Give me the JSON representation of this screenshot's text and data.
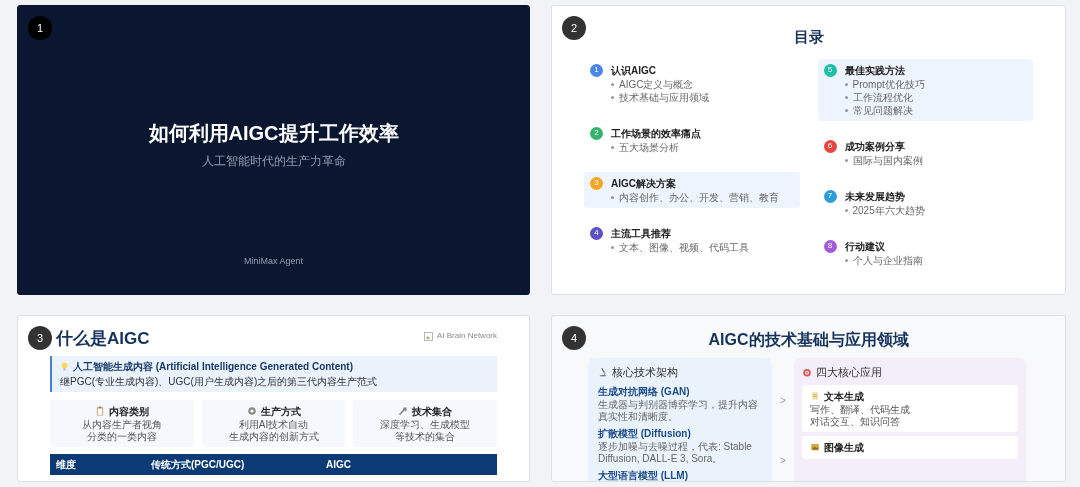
{
  "slides": [
    {
      "number": "1",
      "kind": "title",
      "title": "如何利用AIGC提升工作效率",
      "subtitle": "人工智能时代的生产力革命",
      "footer": "MiniMax Agent"
    },
    {
      "number": "2",
      "kind": "toc",
      "title": "目录",
      "columns": [
        [
          {
            "number": "1",
            "title": "认识AIGC",
            "color": "#4a86e8",
            "highlighted": false,
            "bullets": [
              "AIGC定义与概念",
              "技术基础与应用领域"
            ]
          },
          {
            "number": "2",
            "title": "工作场景的效率痛点",
            "color": "#34b36b",
            "highlighted": false,
            "bullets": [
              "五大场景分析"
            ]
          },
          {
            "number": "3",
            "title": "AIGC解决方案",
            "color": "#f5a623",
            "highlighted": true,
            "bullets": [
              "内容创作、办公、开发、营销、教育"
            ]
          },
          {
            "number": "4",
            "title": "主流工具推荐",
            "color": "#5b4fc4",
            "highlighted": false,
            "bullets": [
              "文本、图像、视频、代码工具"
            ]
          }
        ],
        [
          {
            "number": "5",
            "title": "最佳实践方法",
            "color": "#1bbfa6",
            "highlighted": true,
            "bullets": [
              "Prompt优化技巧",
              "工作流程优化",
              "常见问题解决"
            ]
          },
          {
            "number": "6",
            "title": "成功案例分享",
            "color": "#e8453c",
            "highlighted": false,
            "bullets": [
              "国际与国内案例"
            ]
          },
          {
            "number": "7",
            "title": "未来发展趋势",
            "color": "#2d9cdb",
            "highlighted": false,
            "bullets": [
              "2025年六大趋势"
            ]
          },
          {
            "number": "8",
            "title": "行动建议",
            "color": "#a45ad8",
            "highlighted": false,
            "bullets": [
              "个人与企业指南"
            ]
          }
        ]
      ]
    },
    {
      "number": "3",
      "kind": "intro",
      "title": "什么是AIGC",
      "image_alt": "AI Brain Network",
      "callout": {
        "title": "人工智能生成内容 (Artificial Intelligence Generated Content)",
        "text": "继PGC(专业生成内容)、UGC(用户生成内容)之后的第三代内容生产范式"
      },
      "cards": [
        {
          "title": "内容类别",
          "lines": [
            "从内容生产者视角",
            "分类的一类内容"
          ]
        },
        {
          "title": "生产方式",
          "lines": [
            "利用AI技术自动",
            "生成内容的创新方式"
          ]
        },
        {
          "title": "技术集合",
          "lines": [
            "深度学习、生成模型",
            "等技术的集合"
          ]
        }
      ],
      "table": {
        "columns": [
          "维度",
          "传统方式(PGC/UGC)",
          "AIGC"
        ]
      }
    },
    {
      "number": "4",
      "kind": "tech",
      "title": "AIGC的技术基础与应用领域",
      "left": {
        "title": "核心技术架构",
        "entries": [
          {
            "title": "生成对抗网络 (GAN)",
            "text": "生成器与判别器博弈学习，提升内容真实性和清晰度。"
          },
          {
            "title": "扩散模型 (Diffusion)",
            "text": "逐步加噪与去噪过程，代表: Stable Diffusion, DALL-E 3, Sora。"
          },
          {
            "title": "大型语言模型 (LLM)"
          }
        ]
      },
      "arrows": [
        ">",
        ">"
      ],
      "right": {
        "title": "四大核心应用",
        "cards": [
          {
            "title": "文本生成",
            "lines": [
              "写作、翻译、代码生成",
              "对话交互、知识问答"
            ]
          },
          {
            "title": "图像生成"
          }
        ]
      }
    }
  ]
}
